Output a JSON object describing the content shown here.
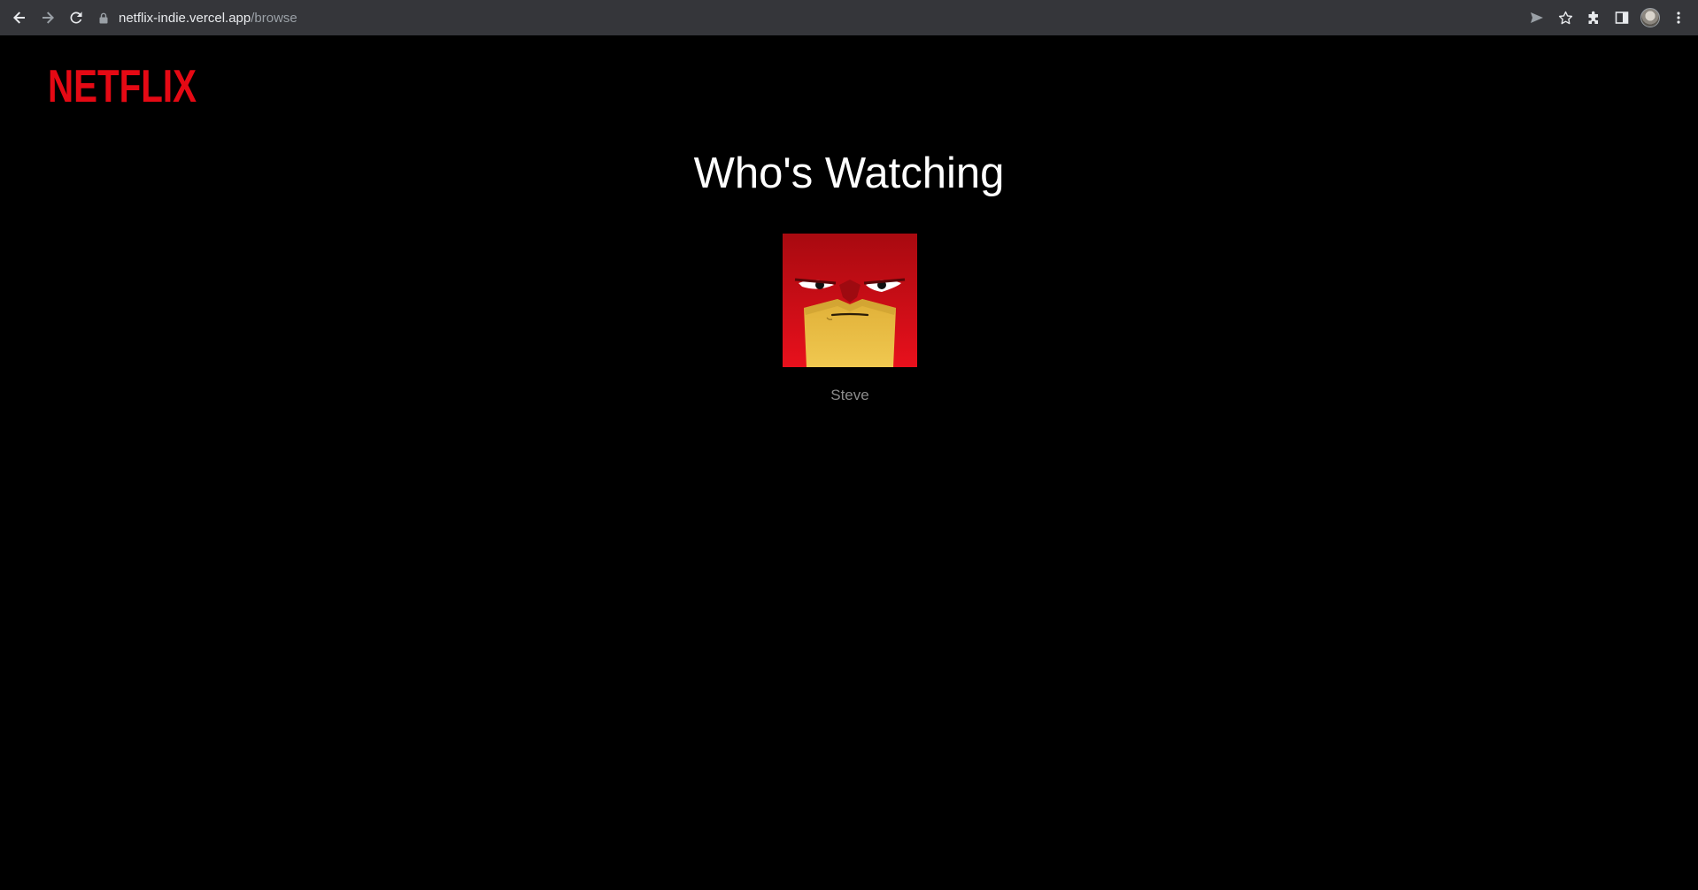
{
  "browser": {
    "url_host": "netflix-indie.vercel.app",
    "url_path": "/browse",
    "icons": [
      "back-icon",
      "forward-icon",
      "reload-icon",
      "lock-icon",
      "send-icon",
      "star-icon",
      "extensions-icon",
      "side-panel-icon",
      "profile-icon",
      "menu-icon"
    ]
  },
  "brand": {
    "logo_text": "NETFLIX",
    "color": "#e50914"
  },
  "main": {
    "title": "Who's Watching",
    "profiles": [
      {
        "name": "Steve",
        "avatar": "angry-red-character-avatar"
      }
    ]
  },
  "colors": {
    "background": "#000000",
    "chrome": "#35363a",
    "title": "#ffffff",
    "profile_name": "#8c8c8c"
  }
}
